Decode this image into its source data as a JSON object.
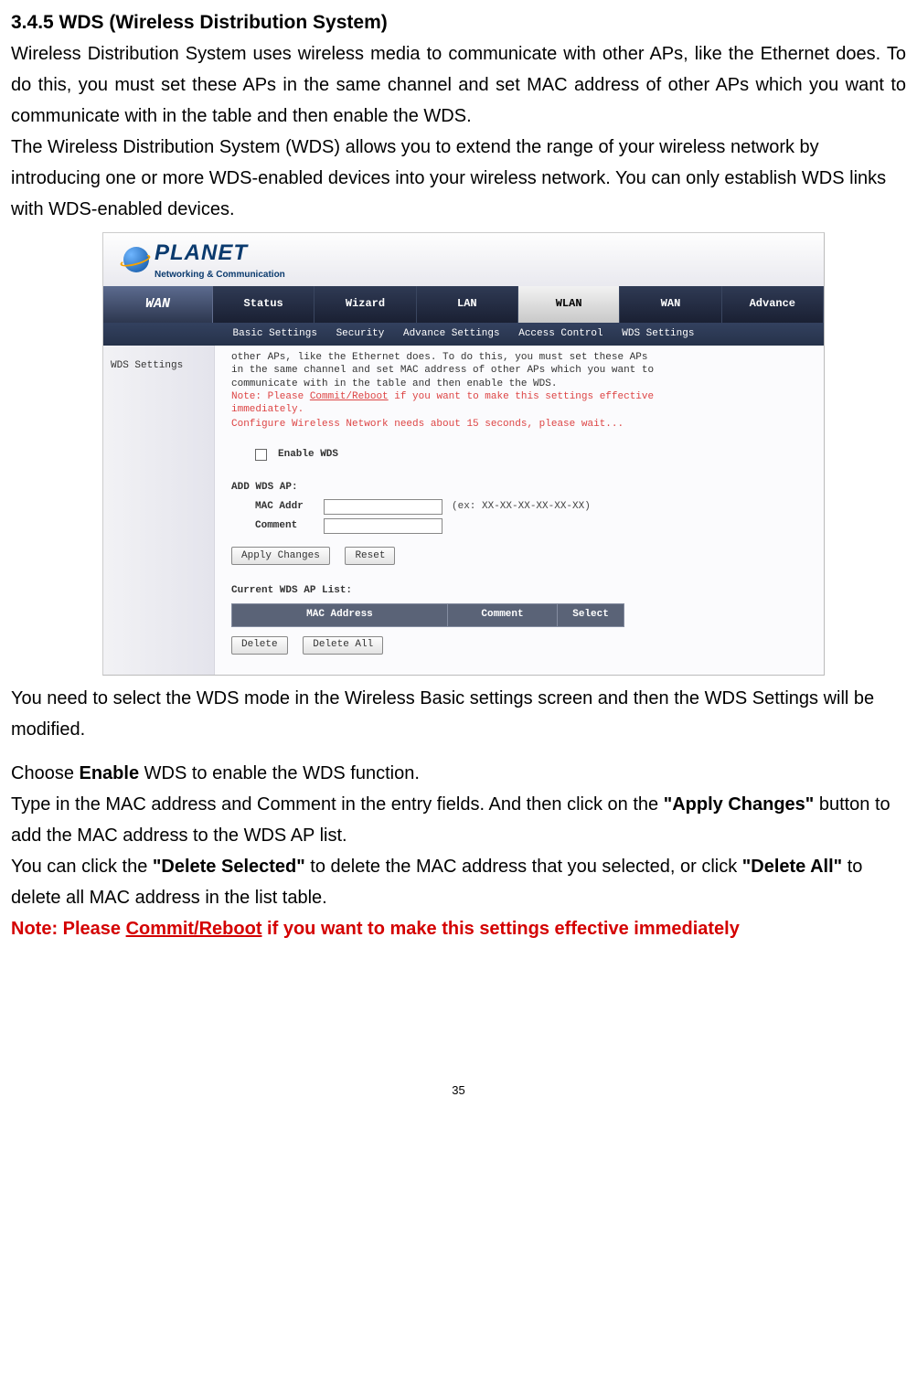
{
  "heading": "3.4.5 WDS (Wireless Distribution System)",
  "intro_para1": "Wireless Distribution System uses wireless media to communicate with other APs, like the Ethernet does. To do this, you must set these APs in the same channel and set MAC address of other APs which you want to communicate with in the table and then enable the WDS.",
  "intro_para2": "The Wireless Distribution System (WDS) allows you to extend the range of your wireless network by introducing one or more WDS-enabled devices into your wireless network. You can only establish WDS links with WDS-enabled devices.",
  "after_para1": "You need to select the WDS mode in the Wireless Basic settings screen and then the WDS Settings will be modified.",
  "enable_line_pre": "Choose ",
  "enable_line_bold": "Enable",
  "enable_line_post": " WDS to enable the WDS function.",
  "type_line_pre": "Type in the MAC address and Comment in the entry fields. And then click on the ",
  "type_line_bold": "\"Apply Changes\"",
  "type_line_post": " button to add the MAC address to the WDS AP list.",
  "delete_line_pre": "You can click the ",
  "delete_line_bold1": "\"Delete Selected\"",
  "delete_line_mid": " to delete the MAC address that you selected, or click ",
  "delete_line_bold2": "\"Delete All\"",
  "delete_line_post": " to delete all MAC address in the list table.",
  "note_pre": "Note: Please ",
  "note_underline": "Commit/Reboot",
  "note_post": " if you want to make this settings effective immediately",
  "page_number": "35",
  "screenshot": {
    "logo_text": "PLANET",
    "logo_sub": "Networking & Communication",
    "nav_left": "WAN",
    "nav_items": [
      "Status",
      "Wizard",
      "LAN",
      "WLAN",
      "WAN",
      "Advance"
    ],
    "nav_active_index": 3,
    "subnav_items": [
      "Basic Settings",
      "Security",
      "Advance Settings",
      "Access Control",
      "WDS Settings"
    ],
    "sidebar_label": "WDS Settings",
    "intro_line1": "other APs, like the Ethernet does. To do this, you must set these APs",
    "intro_line2": "in the same channel and set MAC address of other APs which you want to",
    "intro_line3": "communicate with in the table and then enable the WDS.",
    "intro_note_pre": "Note: Please ",
    "intro_note_u": "Commit/Reboot",
    "intro_note_post": " if you want to make this settings effective",
    "intro_note_line2": "immediately.",
    "intro_wait": "Configure Wireless Network needs about 15 seconds, please wait...",
    "enable_label": "Enable WDS",
    "add_section": "ADD WDS AP:",
    "mac_label": "MAC Addr",
    "mac_hint": "(ex: XX-XX-XX-XX-XX-XX)",
    "comment_label": "Comment",
    "btn_apply": "Apply Changes",
    "btn_reset": "Reset",
    "list_section": "Current WDS AP List:",
    "table_headers": [
      "MAC Address",
      "Comment",
      "Select"
    ],
    "btn_delete": "Delete",
    "btn_delete_all": "Delete All"
  }
}
